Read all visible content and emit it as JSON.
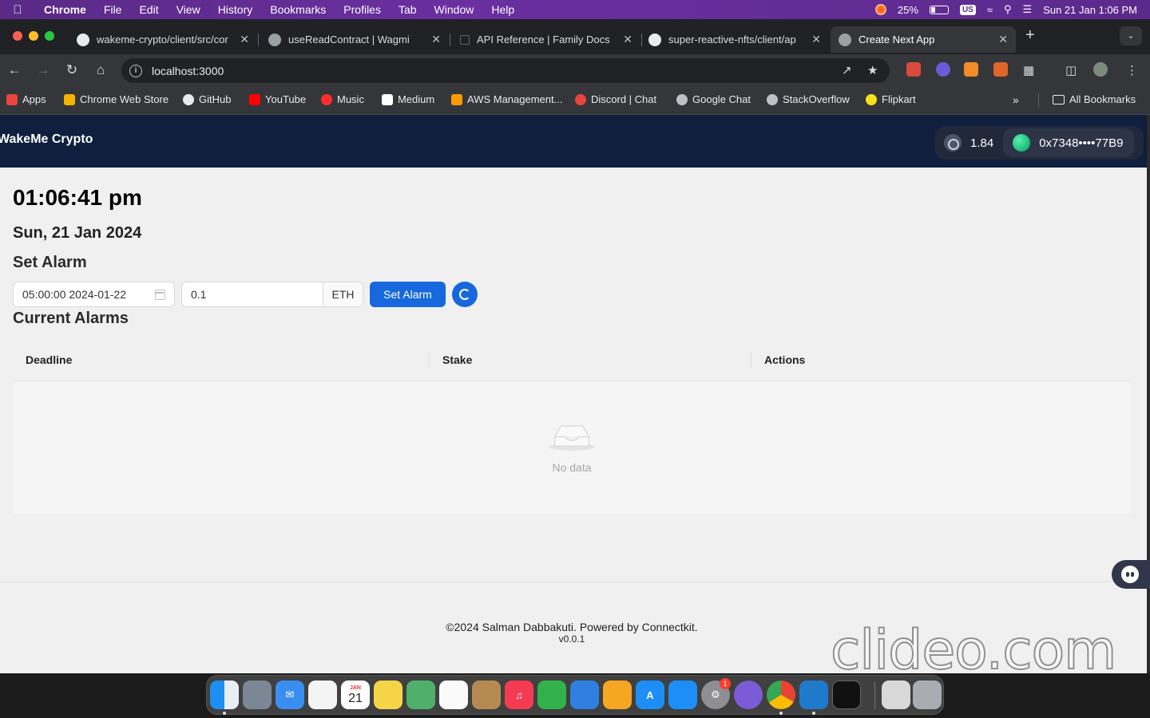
{
  "menubar": {
    "app": "Chrome",
    "items": [
      "File",
      "Edit",
      "View",
      "History",
      "Bookmarks",
      "Profiles",
      "Tab",
      "Window",
      "Help"
    ],
    "battery": "25%",
    "input_source": "US",
    "datetime": "Sun 21 Jan  1:06 PM"
  },
  "tabs": [
    {
      "title": "wakeme-crypto/client/src/cor",
      "icon": "github-icon",
      "active": false
    },
    {
      "title": "useReadContract | Wagmi",
      "icon": "globe-icon",
      "active": false
    },
    {
      "title": "API Reference | Family Docs",
      "icon": "doc-icon",
      "active": false
    },
    {
      "title": "super-reactive-nfts/client/ap",
      "icon": "github-icon",
      "active": false
    },
    {
      "title": "Create Next App",
      "icon": "globe-icon",
      "active": true
    }
  ],
  "omnibox": {
    "url": "localhost:3000"
  },
  "bookmarks": [
    {
      "label": "Apps",
      "color": "#e8453c"
    },
    {
      "label": "Chrome Web Store",
      "color": "#f4b400"
    },
    {
      "label": "GitHub",
      "color": "#e8eaed"
    },
    {
      "label": "YouTube",
      "color": "#ff0000"
    },
    {
      "label": "Music",
      "color": "#ff2d2d"
    },
    {
      "label": "Medium",
      "color": "#ffffff"
    },
    {
      "label": "AWS Management...",
      "color": "#ff9900"
    },
    {
      "label": "Discord | Chat",
      "color": "#e8453c"
    },
    {
      "label": "Google Chat",
      "color": "#bdc1c6"
    },
    {
      "label": "StackOverflow",
      "color": "#bdc1c6"
    },
    {
      "label": "Flipkart",
      "color": "#f7e21b"
    }
  ],
  "all_bookmarks": "All Bookmarks",
  "app": {
    "brand": "WakeMe Crypto",
    "balance": "1.84",
    "address": "0x7348••••77B9",
    "clock": "01:06:41 pm",
    "date": "Sun, 21 Jan 2024",
    "set_alarm_heading": "Set Alarm",
    "deadline_value": "05:00:00 2024-01-22",
    "stake_value": "0.1",
    "stake_unit": "ETH",
    "set_alarm_button": "Set Alarm",
    "current_alarms_heading": "Current Alarms",
    "table": {
      "columns": [
        "Deadline",
        "Stake",
        "Actions"
      ],
      "rows": [],
      "empty_text": "No data"
    },
    "footer": {
      "copyright": "©2024 Salman Dabbakuti. Powered by Connectkit.",
      "version": "v0.0.1"
    }
  },
  "dock": {
    "calendar_month": "JAN",
    "calendar_day": "21",
    "settings_badge": "1"
  },
  "watermark": "clideo.com",
  "colors": {
    "header_bg": "#0f1f3d",
    "primary": "#1668dc",
    "page_bg": "#f0f0f0"
  }
}
